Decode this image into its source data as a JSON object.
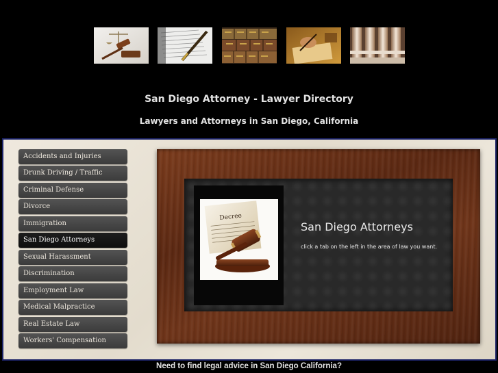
{
  "header": {
    "title": "San Diego Attorney - Lawyer Directory",
    "subtitle": "Lawyers and Attorneys in San Diego, California",
    "photos": [
      "gavel-scales-photo-icon",
      "pen-signing-photo-icon",
      "law-books-photo-icon",
      "writing-hand-photo-icon",
      "courthouse-columns-photo-icon"
    ]
  },
  "nav": {
    "items": [
      {
        "label": "Accidents and Injuries"
      },
      {
        "label": "Drunk Driving / Traffic"
      },
      {
        "label": "Criminal Defense"
      },
      {
        "label": "Divorce"
      },
      {
        "label": "Immigration"
      },
      {
        "label": "San Diego Attorneys"
      },
      {
        "label": "Sexual Harassment"
      },
      {
        "label": "Discrimination"
      },
      {
        "label": "Employment Law"
      },
      {
        "label": "Medical Malpractice"
      },
      {
        "label": "Real Estate Law"
      },
      {
        "label": "Workers' Compensation"
      }
    ],
    "active_label": "San Diego Attorneys"
  },
  "feature": {
    "title": "San Diego Attorneys",
    "text": "click a tab on the left in the area of law you want.",
    "image_caption": "Decree",
    "image_icon": "decree-gavel-image-icon"
  },
  "footer": {
    "text": "Need to find legal advice in San Diego California?"
  },
  "colors": {
    "page_background": "#000000",
    "panel_border": "#1b2266",
    "nav_button": "#464646",
    "nav_active": "#151515",
    "frame_wood": "#6b3218",
    "board": "#292929"
  }
}
